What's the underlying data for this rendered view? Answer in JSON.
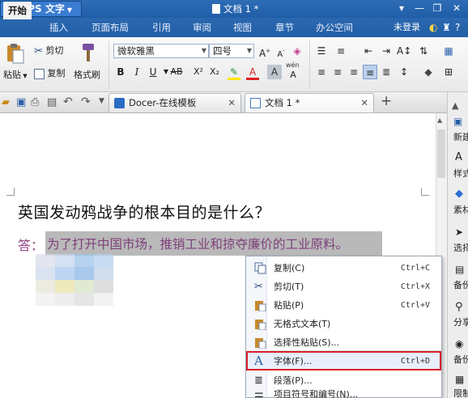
{
  "app": {
    "name": "WPS 文字"
  },
  "window": {
    "title": "文档 1 *"
  },
  "ribbon_tabs": [
    "开始",
    "插入",
    "页面布局",
    "引用",
    "审阅",
    "视图",
    "章节",
    "办公空间"
  ],
  "account": {
    "label": "未登录"
  },
  "ribbon": {
    "clipboard": {
      "paste": "粘贴",
      "cut": "剪切",
      "copy": "复制",
      "format_painter": "格式刷"
    },
    "font_name": "微软雅黑",
    "font_size": "四号",
    "wen_label": "wén"
  },
  "doc_tabs": [
    {
      "label": "Docer-在线模板"
    },
    {
      "label": "文档 1 *"
    }
  ],
  "right_panel": [
    "新建",
    "样式",
    "素材",
    "选择",
    "备份",
    "分享",
    "备份",
    "限制"
  ],
  "document": {
    "question": "英国发动鸦战争的根本目的是什么？",
    "answer_label": "答：",
    "answer_text": "为了打开中国市场，推销工业和掠夺廉价的工业原料。"
  },
  "context_menu": {
    "items": [
      {
        "label": "复制(C)",
        "shortcut": "Ctrl+C"
      },
      {
        "label": "剪切(T)",
        "shortcut": "Ctrl+X"
      },
      {
        "label": "粘贴(P)",
        "shortcut": "Ctrl+V"
      },
      {
        "label": "无格式文本(T)",
        "shortcut": ""
      },
      {
        "label": "选择性粘贴(S)...",
        "shortcut": ""
      },
      {
        "label": "字体(F)...",
        "shortcut": "Ctrl+D"
      },
      {
        "label": "段落(P)...",
        "shortcut": ""
      },
      {
        "label": "项目符号和编号(N)...",
        "shortcut": ""
      }
    ],
    "highlighted_index": 5
  },
  "colors": {
    "title_bar": "#2368b2",
    "highlight_border": "#d8202a",
    "answer_text": "#7e3f7a"
  }
}
